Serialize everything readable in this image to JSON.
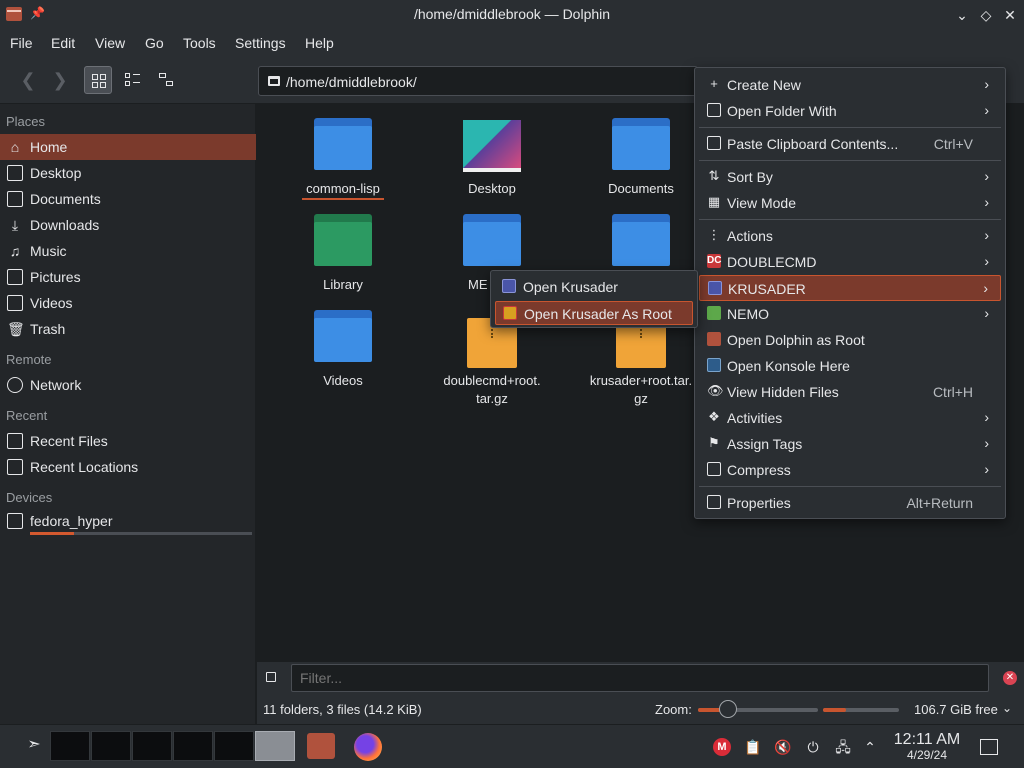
{
  "window": {
    "title": "/home/dmiddlebrook — Dolphin",
    "controls": [
      "minimize",
      "maximize",
      "close"
    ]
  },
  "menubar": [
    "File",
    "Edit",
    "View",
    "Go",
    "Tools",
    "Settings",
    "Help"
  ],
  "toolbar": {
    "location": "/home/dmiddlebrook/",
    "view_modes": [
      "icons",
      "compact",
      "details"
    ],
    "active_view": "icons"
  },
  "sidebar": {
    "places_title": "Places",
    "places": [
      {
        "label": "Home",
        "icon": "home-icon"
      },
      {
        "label": "Desktop",
        "icon": "desktop-icon"
      },
      {
        "label": "Documents",
        "icon": "documents-icon"
      },
      {
        "label": "Downloads",
        "icon": "downloads-icon"
      },
      {
        "label": "Music",
        "icon": "music-icon"
      },
      {
        "label": "Pictures",
        "icon": "pictures-icon"
      },
      {
        "label": "Videos",
        "icon": "videos-icon"
      },
      {
        "label": "Trash",
        "icon": "trash-icon"
      }
    ],
    "remote_title": "Remote",
    "remote": [
      {
        "label": "Network",
        "icon": "network-icon"
      }
    ],
    "recent_title": "Recent",
    "recent": [
      {
        "label": "Recent Files",
        "icon": "recent-files-icon"
      },
      {
        "label": "Recent Locations",
        "icon": "recent-locations-icon"
      }
    ],
    "devices_title": "Devices",
    "devices": [
      {
        "label": "fedora_hyper",
        "icon": "drive-icon",
        "usage_fraction": 0.2
      }
    ]
  },
  "files": {
    "common_lisp": "common-lisp",
    "desktop": "Desktop",
    "documents": "Documents",
    "library": "Library",
    "media_partial": "ME",
    "videos": "Videos",
    "doublecmd_l1": "doublecmd+root.",
    "doublecmd_l2": "tar.gz",
    "krusader_l1": "krusader+root.tar.",
    "krusader_l2": "gz"
  },
  "filter": {
    "placeholder": "Filter..."
  },
  "status": {
    "summary": "11 folders, 3 files (14.2 KiB)",
    "zoom_label": "Zoom:",
    "zoom_fraction": 0.25,
    "free_space": "106.7 GiB free",
    "free_fraction": 0.3
  },
  "context_menu": {
    "create_new": "Create New",
    "open_folder_with": "Open Folder With",
    "paste": "Paste Clipboard Contents...",
    "paste_shortcut": "Ctrl+V",
    "sort_by": "Sort By",
    "view_mode": "View Mode",
    "actions": "Actions",
    "doublecmd": "DOUBLECMD",
    "krusader": "KRUSADER",
    "nemo": "NEMO",
    "open_dolphin_root": "Open Dolphin as Root",
    "open_konsole": "Open Konsole Here",
    "view_hidden": "View Hidden Files",
    "view_hidden_shortcut": "Ctrl+H",
    "activities": "Activities",
    "assign_tags": "Assign Tags",
    "compress": "Compress",
    "properties": "Properties",
    "properties_shortcut": "Alt+Return"
  },
  "submenu": {
    "open_krusader": "Open Krusader",
    "open_krusader_root": "Open Krusader As Root"
  },
  "taskbar": {
    "time": "12:11 AM",
    "date": "4/29/24"
  }
}
